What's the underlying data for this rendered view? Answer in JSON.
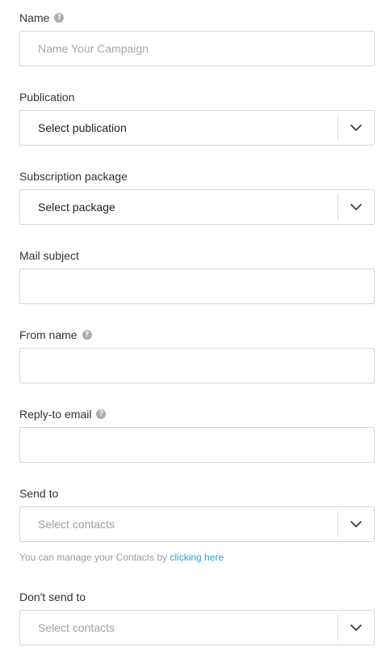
{
  "fields": {
    "name": {
      "label": "Name",
      "placeholder": "Name Your Campaign",
      "value": "",
      "help_icon": "question-mark-icon"
    },
    "publication": {
      "label": "Publication",
      "selected": "Select publication",
      "chevron_icon": "chevron-down-icon"
    },
    "subscription_package": {
      "label": "Subscription package",
      "selected": "Select package",
      "chevron_icon": "chevron-down-icon"
    },
    "mail_subject": {
      "label": "Mail subject",
      "value": ""
    },
    "from_name": {
      "label": "From name",
      "value": "",
      "help_icon": "question-mark-icon"
    },
    "reply_to_email": {
      "label": "Reply-to email",
      "value": "",
      "help_icon": "question-mark-icon"
    },
    "send_to": {
      "label": "Send to",
      "placeholder": "Select contacts",
      "chevron_icon": "chevron-down-icon",
      "hint_text": "You can manage your Contacts by",
      "hint_link": "clicking here"
    },
    "dont_send_to": {
      "label": "Don't send to",
      "placeholder": "Select contacts",
      "chevron_icon": "chevron-down-icon"
    }
  },
  "colors": {
    "border": "#d6d6d6",
    "label_text": "#333333",
    "placeholder_text": "#a7a7a7",
    "link": "#2aa1d3",
    "help_icon_bg": "#a9adb5"
  }
}
